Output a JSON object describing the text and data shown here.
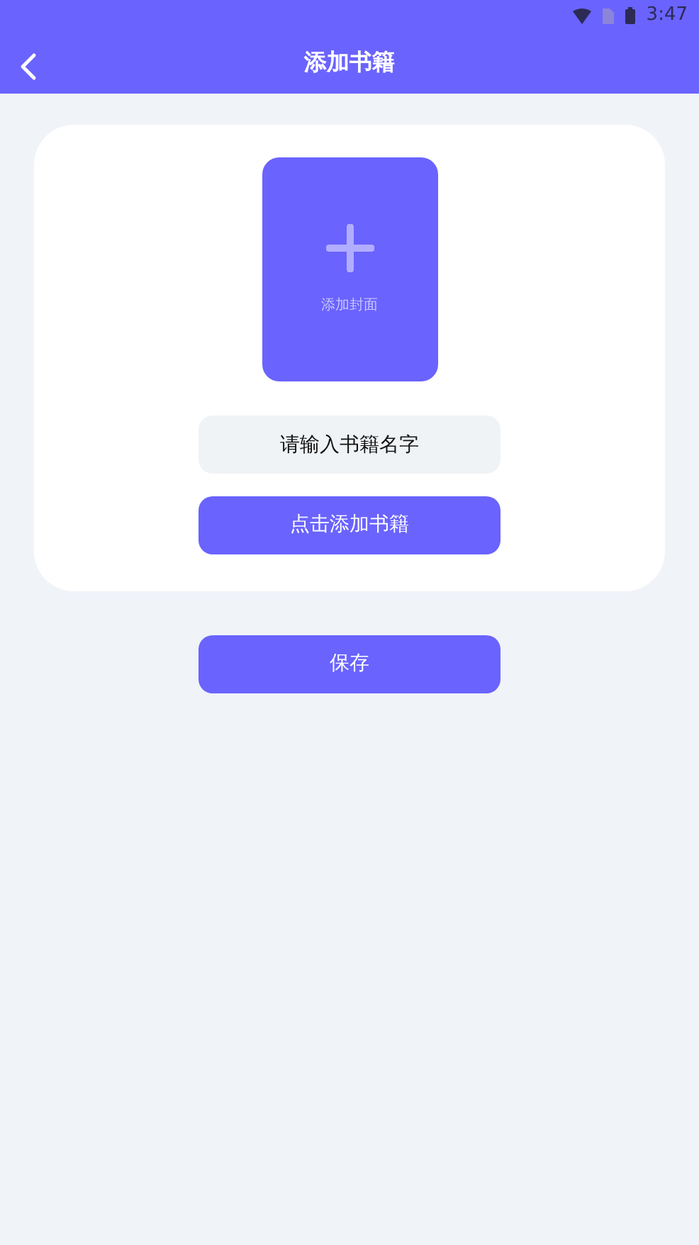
{
  "status_bar": {
    "time": "3:47"
  },
  "header": {
    "title": "添加书籍"
  },
  "cover": {
    "label": "添加封面"
  },
  "name_field": {
    "placeholder": "请输入书籍名字"
  },
  "add_book_button": {
    "label": "点击添加书籍"
  },
  "save_button": {
    "label": "保存"
  }
}
